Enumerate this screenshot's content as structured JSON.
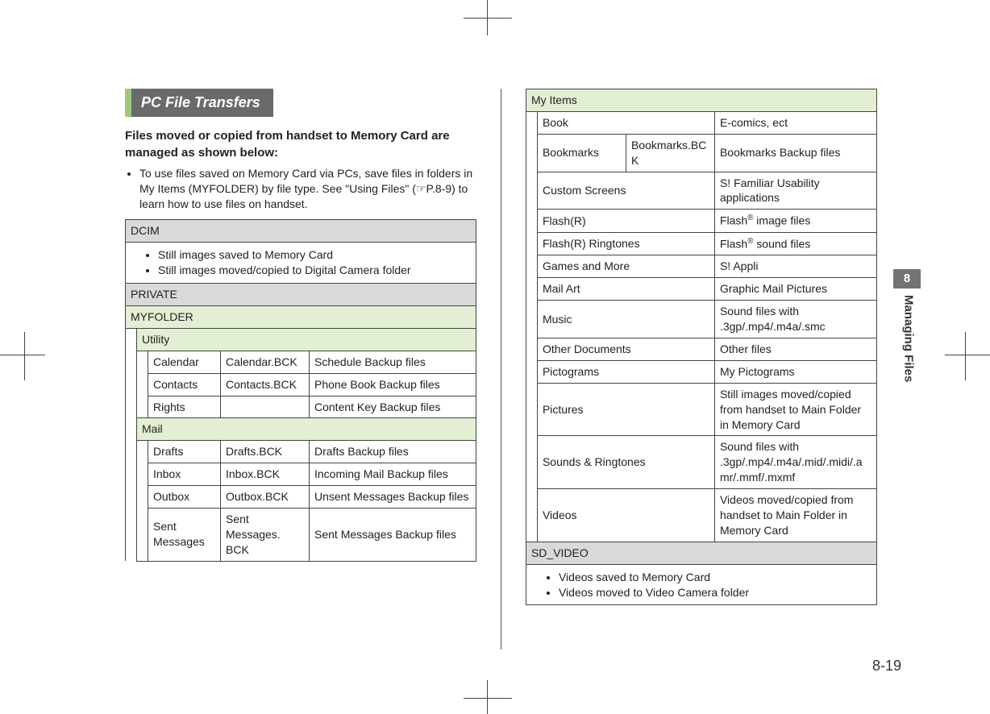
{
  "sidebar": {
    "chapter_number": "8",
    "chapter_title": "Managing Files"
  },
  "page_number": "8-19",
  "section_title": "PC File Transfers",
  "intro_heading": "Files moved or copied from handset to Memory Card are managed as shown below:",
  "intro_bullet": "To use files saved on Memory Card via PCs, save files in folders in My Items (MYFOLDER) by file type. See \"Using Files\" (☞P.8-9) to learn how to use files on handset.",
  "left": {
    "dcim_header": "DCIM",
    "dcim_bullets": [
      "Still images saved to Memory Card",
      "Still images moved/copied to Digital Camera folder"
    ],
    "private_header": "PRIVATE",
    "myfolder_header": "MYFOLDER",
    "utility_header": "Utility",
    "utility_rows": [
      {
        "name": "Calendar",
        "file": "Calendar.BCK",
        "desc": "Schedule Backup files"
      },
      {
        "name": "Contacts",
        "file": "Contacts.BCK",
        "desc": "Phone Book Backup files"
      },
      {
        "name": "Rights",
        "file": "",
        "desc": "Content Key Backup files"
      }
    ],
    "mail_header": "Mail",
    "mail_rows": [
      {
        "name": "Drafts",
        "file": "Drafts.BCK",
        "desc": "Drafts Backup files"
      },
      {
        "name": "Inbox",
        "file": "Inbox.BCK",
        "desc": "Incoming Mail Backup files"
      },
      {
        "name": "Outbox",
        "file": "Outbox.BCK",
        "desc": "Unsent Messages Backup files"
      },
      {
        "name": "Sent Messages",
        "file": "Sent Messages. BCK",
        "desc": "Sent Messages Backup files"
      }
    ]
  },
  "right": {
    "myitems_header": "My Items",
    "myitems_rows": [
      {
        "name": "Book",
        "file": "",
        "desc": "E-comics, ect"
      },
      {
        "name": "Bookmarks",
        "file": "Bookmarks.BCK",
        "desc": "Bookmarks Backup files"
      },
      {
        "name": "Custom Screens",
        "file": "",
        "desc": "S! Familiar Usability applications"
      },
      {
        "name": "Flash(R)",
        "file": "",
        "desc": "Flash® image files"
      },
      {
        "name": "Flash(R) Ringtones",
        "file": "",
        "desc": "Flash® sound files"
      },
      {
        "name": "Games and More",
        "file": "",
        "desc": "S! Appli"
      },
      {
        "name": "Mail Art",
        "file": "",
        "desc": "Graphic Mail Pictures"
      },
      {
        "name": "Music",
        "file": "",
        "desc": "Sound files with .3gp/.mp4/.m4a/.smc"
      },
      {
        "name": "Other Documents",
        "file": "",
        "desc": "Other files"
      },
      {
        "name": "Pictograms",
        "file": "",
        "desc": "My Pictograms"
      },
      {
        "name": "Pictures",
        "file": "",
        "desc": "Still images moved/copied from handset to Main Folder in Memory Card"
      },
      {
        "name": "Sounds & Ringtones",
        "file": "",
        "desc": "Sound files with .3gp/.mp4/.m4a/.mid/.midi/.amr/.mmf/.mxmf"
      },
      {
        "name": "Videos",
        "file": "",
        "desc": "Videos moved/copied from handset to Main Folder in Memory Card"
      }
    ],
    "sdvideo_header": "SD_VIDEO",
    "sdvideo_bullets": [
      "Videos saved to Memory Card",
      "Videos moved to Video Camera folder"
    ]
  }
}
